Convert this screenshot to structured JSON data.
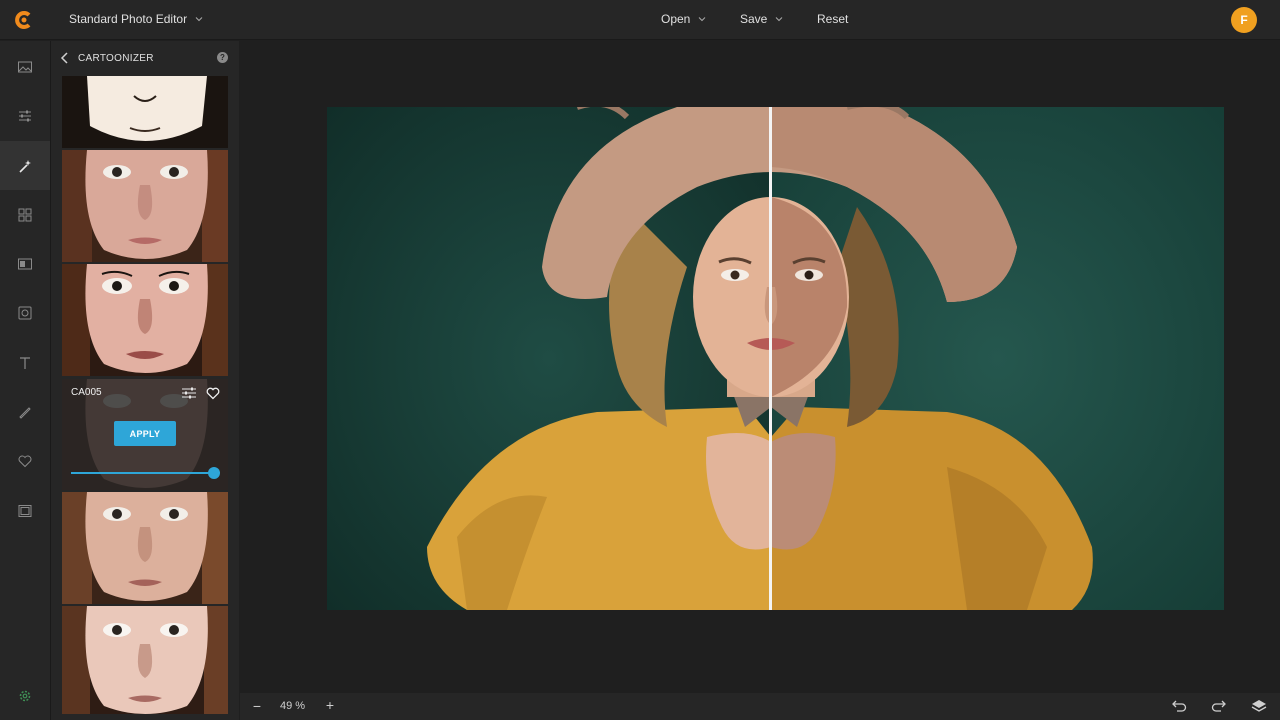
{
  "header": {
    "app_title": "Standard Photo Editor",
    "menu": {
      "open": "Open",
      "save": "Save",
      "reset": "Reset"
    },
    "user_initial": "F"
  },
  "colors": {
    "accent": "#2ea6d8",
    "avatar": "#f0a020",
    "logo": "#f08a1c"
  },
  "rail": {
    "items": [
      "image-icon",
      "adjustments-icon",
      "effects-icon",
      "grid-icon",
      "frame-icon",
      "camera-icon",
      "text-icon",
      "brush-icon",
      "heart-icon",
      "film-icon"
    ],
    "active": "effects-icon"
  },
  "panel": {
    "title": "CARTOONIZER",
    "help": "?",
    "selected": {
      "name": "CA005",
      "apply_label": "APPLY",
      "intensity": 1.0
    }
  },
  "footer": {
    "zoom_out": "−",
    "zoom_value": "49 %",
    "zoom_in": "+"
  }
}
